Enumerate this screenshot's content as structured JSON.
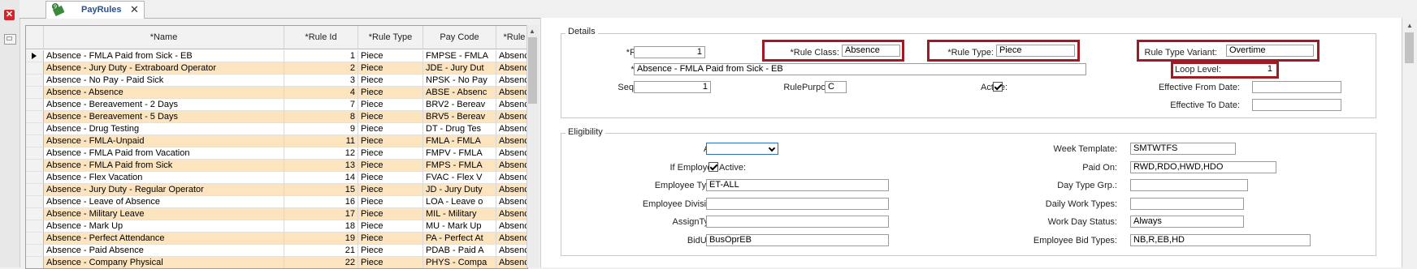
{
  "app": {
    "close_glyph": "✕"
  },
  "tab": {
    "label": "PayRules",
    "close_glyph": "✕",
    "icon": "ruler-document-icon"
  },
  "grid": {
    "columns": [
      "*Name",
      "*Rule Id",
      "*Rule Type",
      "Pay Code",
      "*Rule Clas"
    ],
    "rows": [
      {
        "name": "Absence - FMLA Paid from Sick - EB",
        "id": "1",
        "type": "Piece",
        "pay": "FMPSE - FMLA",
        "cls": "Absence"
      },
      {
        "name": "Absence - Jury Duty - Extraboard Operator",
        "id": "2",
        "type": "Piece",
        "pay": "JDE - Jury Dut",
        "cls": "Absence"
      },
      {
        "name": "Absence - No Pay - Paid Sick",
        "id": "3",
        "type": "Piece",
        "pay": "NPSK - No Pay",
        "cls": "Absence"
      },
      {
        "name": "Absence - Absence",
        "id": "4",
        "type": "Piece",
        "pay": "ABSE - Absenc",
        "cls": "Absence"
      },
      {
        "name": "Absence - Bereavement - 2 Days",
        "id": "7",
        "type": "Piece",
        "pay": "BRV2 - Bereav",
        "cls": "Absence"
      },
      {
        "name": "Absence - Bereavement - 5 Days",
        "id": "8",
        "type": "Piece",
        "pay": "BRV5 - Bereav",
        "cls": "Absence"
      },
      {
        "name": "Absence - Drug Testing",
        "id": "9",
        "type": "Piece",
        "pay": "DT - Drug Tes",
        "cls": "Absence"
      },
      {
        "name": "Absence - FMLA-Unpaid",
        "id": "11",
        "type": "Piece",
        "pay": "FMLA - FMLA",
        "cls": "Absence"
      },
      {
        "name": "Absence - FMLA Paid from Vacation",
        "id": "12",
        "type": "Piece",
        "pay": "FMPV - FMLA",
        "cls": "Absence"
      },
      {
        "name": "Absence - FMLA Paid from Sick",
        "id": "13",
        "type": "Piece",
        "pay": "FMPS - FMLA",
        "cls": "Absence"
      },
      {
        "name": "Absence - Flex Vacation",
        "id": "14",
        "type": "Piece",
        "pay": "FVAC - Flex V",
        "cls": "Absence"
      },
      {
        "name": "Absence - Jury Duty - Regular Operator",
        "id": "15",
        "type": "Piece",
        "pay": "JD - Jury Duty",
        "cls": "Absence"
      },
      {
        "name": "Absence - Leave of Absence",
        "id": "16",
        "type": "Piece",
        "pay": "LOA  - Leave o",
        "cls": "Absence"
      },
      {
        "name": "Absence - Military Leave",
        "id": "17",
        "type": "Piece",
        "pay": "MIL  - Military",
        "cls": "Absence"
      },
      {
        "name": "Absence - Mark Up",
        "id": "18",
        "type": "Piece",
        "pay": "MU - Mark Up",
        "cls": "Absence"
      },
      {
        "name": "Absence - Perfect Attendance",
        "id": "19",
        "type": "Piece",
        "pay": "PA - Perfect At",
        "cls": "Absence"
      },
      {
        "name": "Absence - Paid Absence",
        "id": "21",
        "type": "Piece",
        "pay": "PDAB - Paid A",
        "cls": "Absence"
      },
      {
        "name": "Absence - Company Physical",
        "id": "22",
        "type": "Piece",
        "pay": "PHYS - Compa",
        "cls": "Absence"
      }
    ],
    "row_colors": {
      "alt": "#fce4bf",
      "normal": "#ffffff"
    }
  },
  "details": {
    "group_label": "Details",
    "rule_id_label": "*Rule Id:",
    "rule_id": "1",
    "name_label": "*Name:",
    "name": "Absence - FMLA Paid from Sick - EB",
    "sequence_label": "Sequence:",
    "sequence": "1",
    "rule_class_label": "*Rule Class:",
    "rule_class": "Absence",
    "rule_purpose_label": "RulePurpose:",
    "rule_purpose": "C",
    "rule_type_label": "*Rule Type:",
    "rule_type": "Piece",
    "active_label": "Active:",
    "variant_label": "Rule Type Variant:",
    "variant": "Overtime",
    "loop_level_label": "Loop Level:",
    "loop_level": "1",
    "eff_from_label": "Effective From Date:",
    "eff_from": "",
    "eff_to_label": "Effective To Date:",
    "eff_to": ""
  },
  "eligibility": {
    "group_label": "Eligibility",
    "agency_label": "Agency Id:",
    "agency": "",
    "if_active_label": "If Employee Active:",
    "emp_type_label": "Employee Type Group:",
    "emp_type": "ET-ALL",
    "division_label": "Employee Division Group:",
    "division": "",
    "assign_label": "AssignTypeGroup:",
    "assign": "",
    "bidunit_label": "BidUnit Group:",
    "bidunit": "BusOprEB",
    "week_template_label": "Week Template:",
    "week_template": "SMTWTFS",
    "paid_on_label": "Paid On:",
    "paid_on": "RWD,RDO,HWD,HDO",
    "day_type_label": "Day Type Grp.:",
    "day_type": "",
    "daily_work_label": "Daily Work Types:",
    "daily_work": "",
    "work_day_status_label": "Work Day Status:",
    "work_day_status": "Always",
    "bid_types_label": "Employee Bid Types:",
    "bid_types": "NB,R,EB,HD"
  },
  "colors": {
    "highlight": "#9e1b23",
    "tab_text": "#2a4f8f",
    "close_red": "#d4232d"
  }
}
